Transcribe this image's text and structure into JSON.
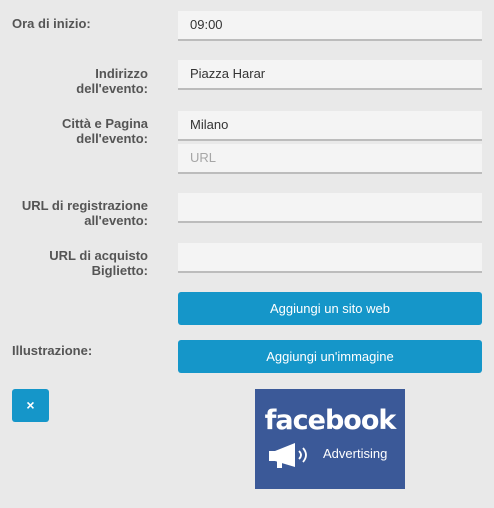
{
  "fields": {
    "start_time": {
      "label": "Ora di inizio:",
      "value": "09:00"
    },
    "address": {
      "label_line1": "Indirizzo",
      "label_line2": "dell'evento:",
      "value": "Piazza Harar"
    },
    "city_page": {
      "label_line1": "Città e Pagina",
      "label_line2": "dell'evento:",
      "city_value": "Milano",
      "url_placeholder": "URL"
    },
    "registration_url": {
      "label_line1": "URL di registrazione",
      "label_line2": "all'evento:",
      "value": ""
    },
    "ticket_url": {
      "label_line1": "URL di acquisto",
      "label_line2": "Biglietto:",
      "value": ""
    }
  },
  "buttons": {
    "add_website": "Aggiungi un sito web",
    "add_image": "Aggiungi un'immagine",
    "remove": "×"
  },
  "illustration": {
    "label": "Illustrazione:",
    "image_brand": "facebook",
    "image_caption": "Advertising",
    "image_bg_color": "#3b5998"
  },
  "colors": {
    "accent": "#1596c9",
    "background": "#e9e9e9",
    "label_text": "#555555"
  }
}
